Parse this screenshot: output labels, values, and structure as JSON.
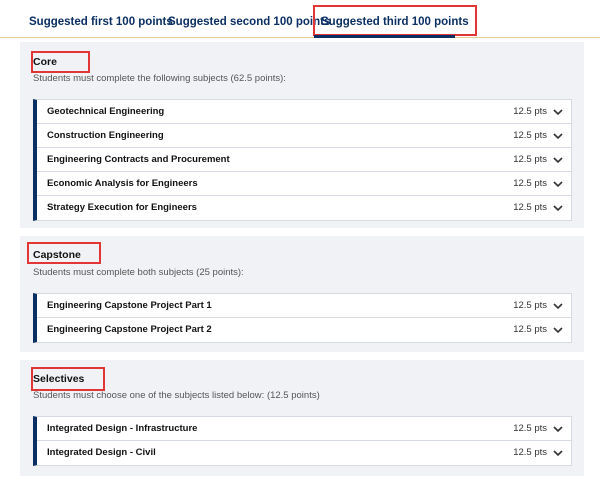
{
  "tabs": [
    {
      "label": "Suggested first 100 points"
    },
    {
      "label": "Suggested second 100 points"
    },
    {
      "label": "Suggested third 100 points",
      "active": true
    }
  ],
  "sections": [
    {
      "title": "Core",
      "description": "Students must complete the following subjects (62.5 points):",
      "subjects": [
        {
          "name": "Geotechnical Engineering",
          "points": "12.5 pts"
        },
        {
          "name": "Construction Engineering",
          "points": "12.5 pts"
        },
        {
          "name": "Engineering Contracts and Procurement",
          "points": "12.5 pts"
        },
        {
          "name": "Economic Analysis for Engineers",
          "points": "12.5 pts"
        },
        {
          "name": "Strategy Execution for Engineers",
          "points": "12.5 pts"
        }
      ]
    },
    {
      "title": "Capstone",
      "description": "Students must complete both subjects (25 points):",
      "subjects": [
        {
          "name": "Engineering Capstone Project Part 1",
          "points": "12.5 pts"
        },
        {
          "name": "Engineering Capstone Project Part 2",
          "points": "12.5 pts"
        }
      ]
    },
    {
      "title": "Selectives",
      "description": "Students must choose one of the subjects listed below: (12.5 points)",
      "subjects": [
        {
          "name": "Integrated Design - Infrastructure",
          "points": "12.5 pts"
        },
        {
          "name": "Integrated Design - Civil",
          "points": "12.5 pts"
        }
      ]
    }
  ],
  "colors": {
    "accent": "#0b2f63",
    "highlight": "#e23636",
    "section_bg": "#f0f2f5",
    "tab_rule": "#e8c98e"
  },
  "icons": {
    "row_toggle": "chevron-down-icon"
  }
}
